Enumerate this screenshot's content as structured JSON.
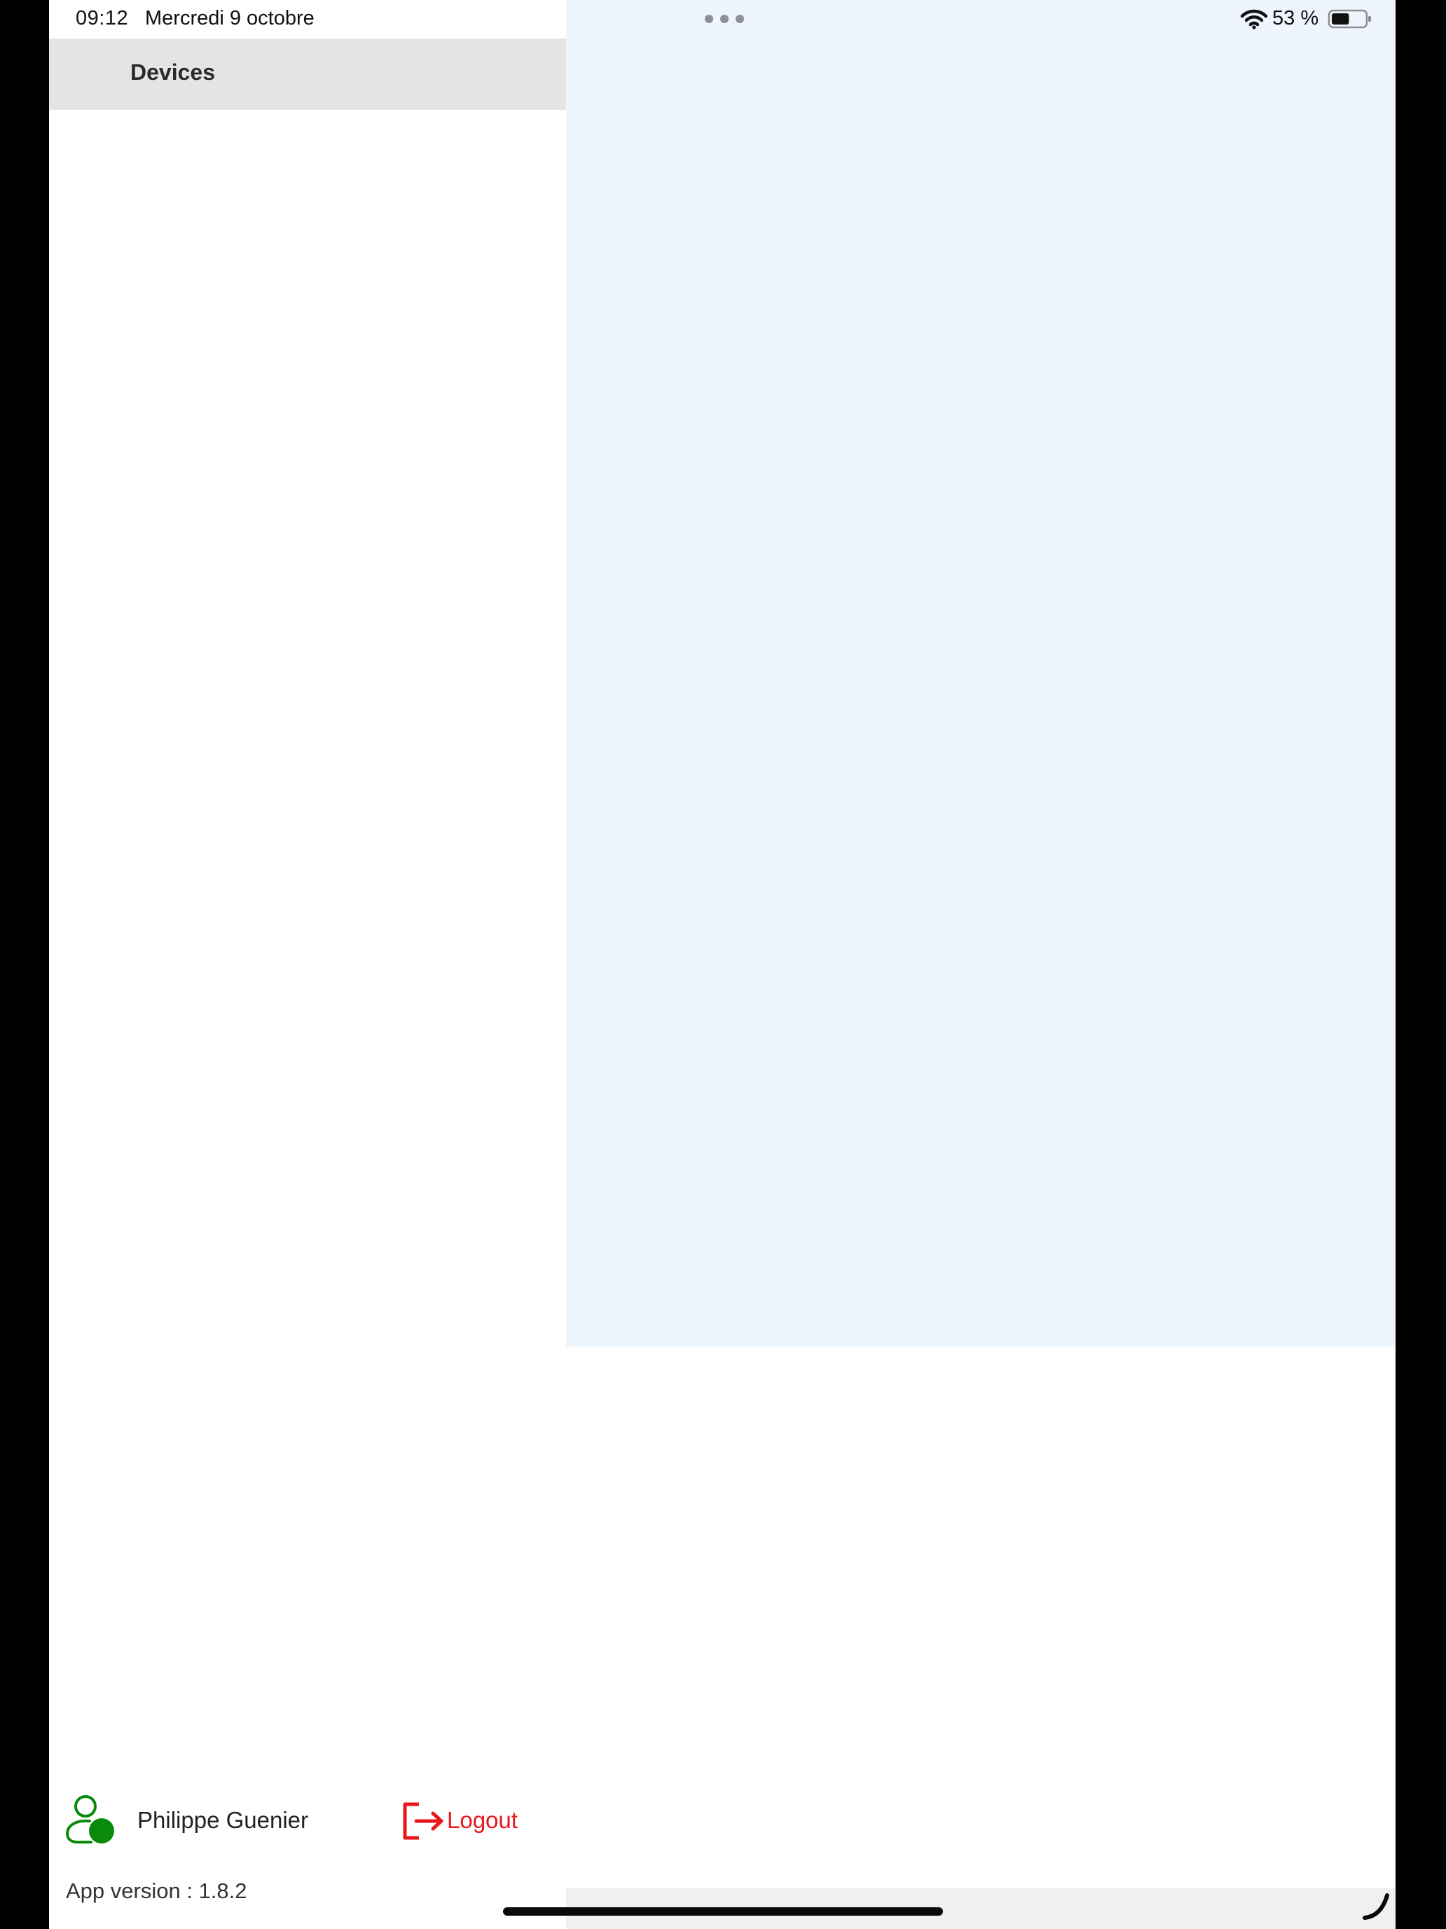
{
  "status_bar": {
    "time": "09:12",
    "date": "Mercredi 9 octobre",
    "battery_percent": "53 %",
    "battery_level": 0.53,
    "icons": [
      "multitask-dots-icon",
      "wifi-icon",
      "battery-icon"
    ]
  },
  "sidebar": {
    "title": "Devices",
    "user": {
      "name": "Philippe Guenier",
      "icon": "user-status-icon"
    },
    "logout": {
      "label": "Logout",
      "icon": "logout-icon"
    },
    "app_version": "App version : 1.8.2"
  },
  "colors": {
    "header_bg": "#e4e4e4",
    "detail_bg": "#eef5fd",
    "user_icon": "#0a8a0a",
    "logout": "#e8171c"
  }
}
